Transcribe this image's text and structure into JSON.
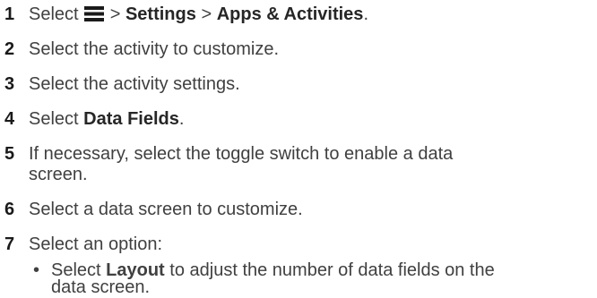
{
  "steps": [
    {
      "number": "1",
      "select": "Select",
      "gt1": ">",
      "settings": "Settings",
      "gt2": ">",
      "apps": "Apps & Activities",
      "period": "."
    },
    {
      "number": "2",
      "text": "Select the activity to customize."
    },
    {
      "number": "3",
      "text": "Select the activity settings."
    },
    {
      "number": "4",
      "pre": "Select ",
      "bold": "Data Fields",
      "post": "."
    },
    {
      "number": "5",
      "text": "If necessary, select the toggle switch to enable a data",
      "text2": "screen."
    },
    {
      "number": "6",
      "text": "Select a data screen to customize."
    },
    {
      "number": "7",
      "text": "Select an option:"
    }
  ],
  "options": [
    {
      "bullet": "•",
      "pre": "Select ",
      "bold": "Layout",
      "post": " to adjust the number of data fields on the",
      "line2": "data screen."
    }
  ],
  "icons": {
    "menu": "menu-icon"
  }
}
